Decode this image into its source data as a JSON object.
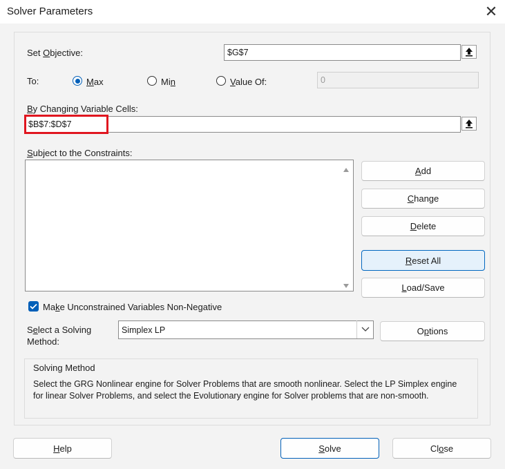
{
  "window": {
    "title": "Solver Parameters",
    "close_glyph": "✕"
  },
  "objective": {
    "label_pre": "Set ",
    "label_key": "O",
    "label_post": "bjective:",
    "value": "$G$7"
  },
  "to": {
    "label": "To:",
    "max": {
      "key": "M",
      "rest": "ax",
      "checked": true
    },
    "min": {
      "pre": "Mi",
      "key": "n",
      "checked": false
    },
    "value_of": {
      "key": "V",
      "rest": "alue Of:",
      "checked": false
    },
    "value_of_field": "0"
  },
  "changing": {
    "label_key": "B",
    "label_rest": "y Changing Variable Cells:",
    "value": "$B$7:$D$7"
  },
  "constraints": {
    "label_key": "S",
    "label_rest": "ubject to the Constraints:",
    "items": []
  },
  "buttons": {
    "add": {
      "key": "A",
      "rest": "dd"
    },
    "change": {
      "key": "C",
      "rest": "hange"
    },
    "delete": {
      "key": "D",
      "rest": "elete"
    },
    "reset": {
      "key": "R",
      "rest": "eset All"
    },
    "load": {
      "key": "L",
      "rest": "oad/Save"
    },
    "options": {
      "pre": "O",
      "key": "p",
      "rest": "tions"
    },
    "help": {
      "key": "H",
      "rest": "elp"
    },
    "solve": {
      "key": "S",
      "rest": "olve"
    },
    "close": {
      "pre": "Cl",
      "key": "o",
      "rest": "se"
    }
  },
  "non_negative": {
    "checked": true,
    "key": "k",
    "label_pre": "Ma",
    "label_rest": "e Unconstrained Variables Non-Negative"
  },
  "method": {
    "label_line1_pre": "S",
    "label_line1_key": "e",
    "label_line1_rest": "lect a Solving",
    "label_line2": "Method:",
    "selected": "Simplex LP"
  },
  "solving_method": {
    "title": "Solving Method",
    "description": "Select the GRG Nonlinear engine for Solver Problems that are smooth nonlinear. Select the LP Simplex engine for linear Solver Problems, and select the Evolutionary engine for Solver problems that are non-smooth."
  },
  "colors": {
    "accent": "#005fb8",
    "highlight_box": "#e0161f"
  }
}
